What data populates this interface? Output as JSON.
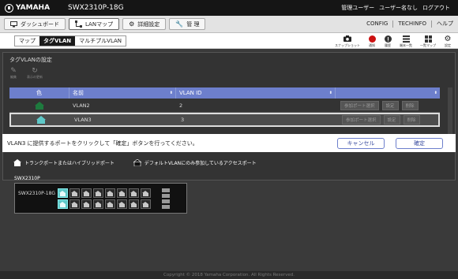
{
  "header": {
    "brand": "YAMAHA",
    "model": "SWX2310P-18G",
    "links": [
      "管理ユーザー",
      "ユーザー名なし",
      "ログアウト"
    ]
  },
  "nav": {
    "tabs": [
      {
        "label": "ダッシュボード",
        "icon": "monitor-icon"
      },
      {
        "label": "LANマップ",
        "icon": "lanmap-icon",
        "active": true
      },
      {
        "label": "詳細設定",
        "icon": "gear-icon"
      },
      {
        "label": "管 理",
        "icon": "wrench-icon"
      }
    ],
    "right_links": [
      "CONFIG",
      "TECHINFO",
      "ヘルプ"
    ]
  },
  "subtabs": [
    "マップ",
    "タグVLAN",
    "マルチプルVLAN"
  ],
  "toolbar": {
    "tools": [
      {
        "label": "スナップショット",
        "icon": "camera-icon"
      },
      {
        "label": "通知",
        "icon": "alert-icon"
      },
      {
        "label": "履歴",
        "icon": "info-icon"
      },
      {
        "label": "端末一覧",
        "icon": "list-icon"
      },
      {
        "label": "一覧マップ",
        "icon": "grid-icon"
      },
      {
        "label": "設定",
        "icon": "gear-icon"
      }
    ]
  },
  "vlan_panel": {
    "title": "タグVLANの設定",
    "tools": [
      {
        "label": "編集",
        "icon": "edit-icon"
      },
      {
        "label": "表示の更新",
        "icon": "refresh-icon"
      }
    ],
    "columns": [
      "色",
      "名前",
      "VLAN ID",
      ""
    ],
    "rows": [
      {
        "color": "#1e7a3e",
        "name": "VLAN2",
        "id": "2",
        "selected": false
      },
      {
        "color": "#5ec8c8",
        "name": "VLAN3",
        "id": "3",
        "selected": true
      }
    ],
    "row_buttons": [
      "参加ポート選択",
      "設定",
      "削除"
    ]
  },
  "message": {
    "text": "VLAN3 に提供するポートをクリックして「確定」ボタンを行ってください。",
    "cancel": "キャンセル",
    "confirm": "確定"
  },
  "legend": {
    "trunk": "トランクポートまたはハイブリッドポート",
    "access": "デフォルトVLANにのみ参加しているアクセスポート"
  },
  "switch": {
    "label": "SWX2310P",
    "name": "SWX2310P-18G"
  },
  "footer": "Copyright © 2018 Yamaha Corporation. All Rights Reserved."
}
